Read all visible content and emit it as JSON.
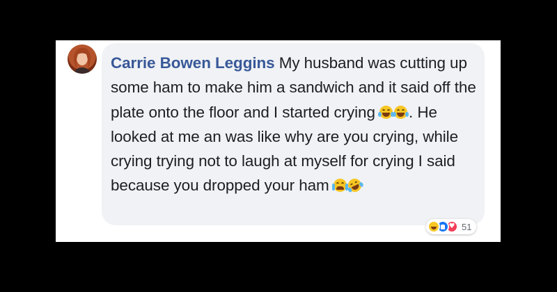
{
  "comment": {
    "author": "Carrie Bowen Leggins",
    "text_part1": "My husband was cutting up some ham to make him a sandwich and it said off the plate onto the floor and I started crying",
    "text_part2": ". He looked at me an was like why are you crying, while crying trying not to laugh at myself for crying I said because you dropped your ham",
    "inline_emojis_1": [
      "laughing-tears-emoji",
      "laughing-tears-emoji"
    ],
    "inline_emojis_2": [
      "loudly-crying-emoji",
      "rolling-laughing-emoji"
    ]
  },
  "reactions": {
    "types": [
      "haha-reaction",
      "like-reaction",
      "love-reaction"
    ],
    "count": "51"
  },
  "colors": {
    "author": "#385898",
    "bubble": "#f0f2f5",
    "text": "#1c1e21",
    "background": "#000000"
  }
}
